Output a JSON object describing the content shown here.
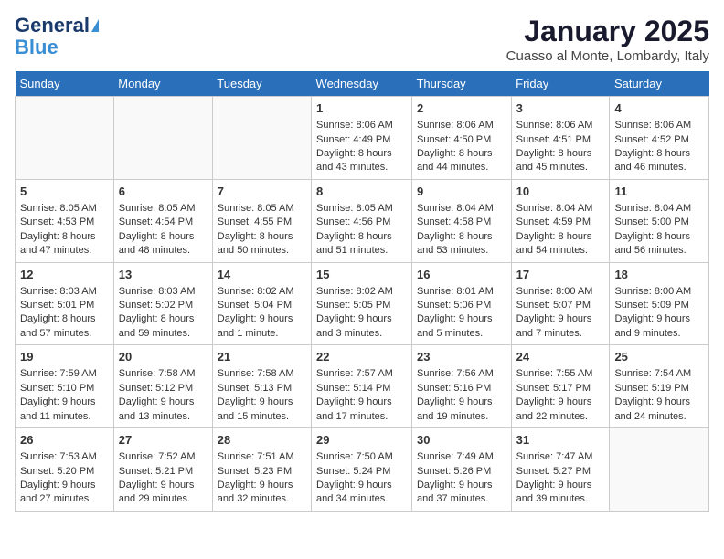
{
  "logo": {
    "line1": "General",
    "line2": "Blue"
  },
  "title": "January 2025",
  "location": "Cuasso al Monte, Lombardy, Italy",
  "days_header": [
    "Sunday",
    "Monday",
    "Tuesday",
    "Wednesday",
    "Thursday",
    "Friday",
    "Saturday"
  ],
  "weeks": [
    [
      {
        "day": "",
        "data": ""
      },
      {
        "day": "",
        "data": ""
      },
      {
        "day": "",
        "data": ""
      },
      {
        "day": "1",
        "data": "Sunrise: 8:06 AM\nSunset: 4:49 PM\nDaylight: 8 hours and 43 minutes."
      },
      {
        "day": "2",
        "data": "Sunrise: 8:06 AM\nSunset: 4:50 PM\nDaylight: 8 hours and 44 minutes."
      },
      {
        "day": "3",
        "data": "Sunrise: 8:06 AM\nSunset: 4:51 PM\nDaylight: 8 hours and 45 minutes."
      },
      {
        "day": "4",
        "data": "Sunrise: 8:06 AM\nSunset: 4:52 PM\nDaylight: 8 hours and 46 minutes."
      }
    ],
    [
      {
        "day": "5",
        "data": "Sunrise: 8:05 AM\nSunset: 4:53 PM\nDaylight: 8 hours and 47 minutes."
      },
      {
        "day": "6",
        "data": "Sunrise: 8:05 AM\nSunset: 4:54 PM\nDaylight: 8 hours and 48 minutes."
      },
      {
        "day": "7",
        "data": "Sunrise: 8:05 AM\nSunset: 4:55 PM\nDaylight: 8 hours and 50 minutes."
      },
      {
        "day": "8",
        "data": "Sunrise: 8:05 AM\nSunset: 4:56 PM\nDaylight: 8 hours and 51 minutes."
      },
      {
        "day": "9",
        "data": "Sunrise: 8:04 AM\nSunset: 4:58 PM\nDaylight: 8 hours and 53 minutes."
      },
      {
        "day": "10",
        "data": "Sunrise: 8:04 AM\nSunset: 4:59 PM\nDaylight: 8 hours and 54 minutes."
      },
      {
        "day": "11",
        "data": "Sunrise: 8:04 AM\nSunset: 5:00 PM\nDaylight: 8 hours and 56 minutes."
      }
    ],
    [
      {
        "day": "12",
        "data": "Sunrise: 8:03 AM\nSunset: 5:01 PM\nDaylight: 8 hours and 57 minutes."
      },
      {
        "day": "13",
        "data": "Sunrise: 8:03 AM\nSunset: 5:02 PM\nDaylight: 8 hours and 59 minutes."
      },
      {
        "day": "14",
        "data": "Sunrise: 8:02 AM\nSunset: 5:04 PM\nDaylight: 9 hours and 1 minute."
      },
      {
        "day": "15",
        "data": "Sunrise: 8:02 AM\nSunset: 5:05 PM\nDaylight: 9 hours and 3 minutes."
      },
      {
        "day": "16",
        "data": "Sunrise: 8:01 AM\nSunset: 5:06 PM\nDaylight: 9 hours and 5 minutes."
      },
      {
        "day": "17",
        "data": "Sunrise: 8:00 AM\nSunset: 5:07 PM\nDaylight: 9 hours and 7 minutes."
      },
      {
        "day": "18",
        "data": "Sunrise: 8:00 AM\nSunset: 5:09 PM\nDaylight: 9 hours and 9 minutes."
      }
    ],
    [
      {
        "day": "19",
        "data": "Sunrise: 7:59 AM\nSunset: 5:10 PM\nDaylight: 9 hours and 11 minutes."
      },
      {
        "day": "20",
        "data": "Sunrise: 7:58 AM\nSunset: 5:12 PM\nDaylight: 9 hours and 13 minutes."
      },
      {
        "day": "21",
        "data": "Sunrise: 7:58 AM\nSunset: 5:13 PM\nDaylight: 9 hours and 15 minutes."
      },
      {
        "day": "22",
        "data": "Sunrise: 7:57 AM\nSunset: 5:14 PM\nDaylight: 9 hours and 17 minutes."
      },
      {
        "day": "23",
        "data": "Sunrise: 7:56 AM\nSunset: 5:16 PM\nDaylight: 9 hours and 19 minutes."
      },
      {
        "day": "24",
        "data": "Sunrise: 7:55 AM\nSunset: 5:17 PM\nDaylight: 9 hours and 22 minutes."
      },
      {
        "day": "25",
        "data": "Sunrise: 7:54 AM\nSunset: 5:19 PM\nDaylight: 9 hours and 24 minutes."
      }
    ],
    [
      {
        "day": "26",
        "data": "Sunrise: 7:53 AM\nSunset: 5:20 PM\nDaylight: 9 hours and 27 minutes."
      },
      {
        "day": "27",
        "data": "Sunrise: 7:52 AM\nSunset: 5:21 PM\nDaylight: 9 hours and 29 minutes."
      },
      {
        "day": "28",
        "data": "Sunrise: 7:51 AM\nSunset: 5:23 PM\nDaylight: 9 hours and 32 minutes."
      },
      {
        "day": "29",
        "data": "Sunrise: 7:50 AM\nSunset: 5:24 PM\nDaylight: 9 hours and 34 minutes."
      },
      {
        "day": "30",
        "data": "Sunrise: 7:49 AM\nSunset: 5:26 PM\nDaylight: 9 hours and 37 minutes."
      },
      {
        "day": "31",
        "data": "Sunrise: 7:47 AM\nSunset: 5:27 PM\nDaylight: 9 hours and 39 minutes."
      },
      {
        "day": "",
        "data": ""
      }
    ]
  ]
}
